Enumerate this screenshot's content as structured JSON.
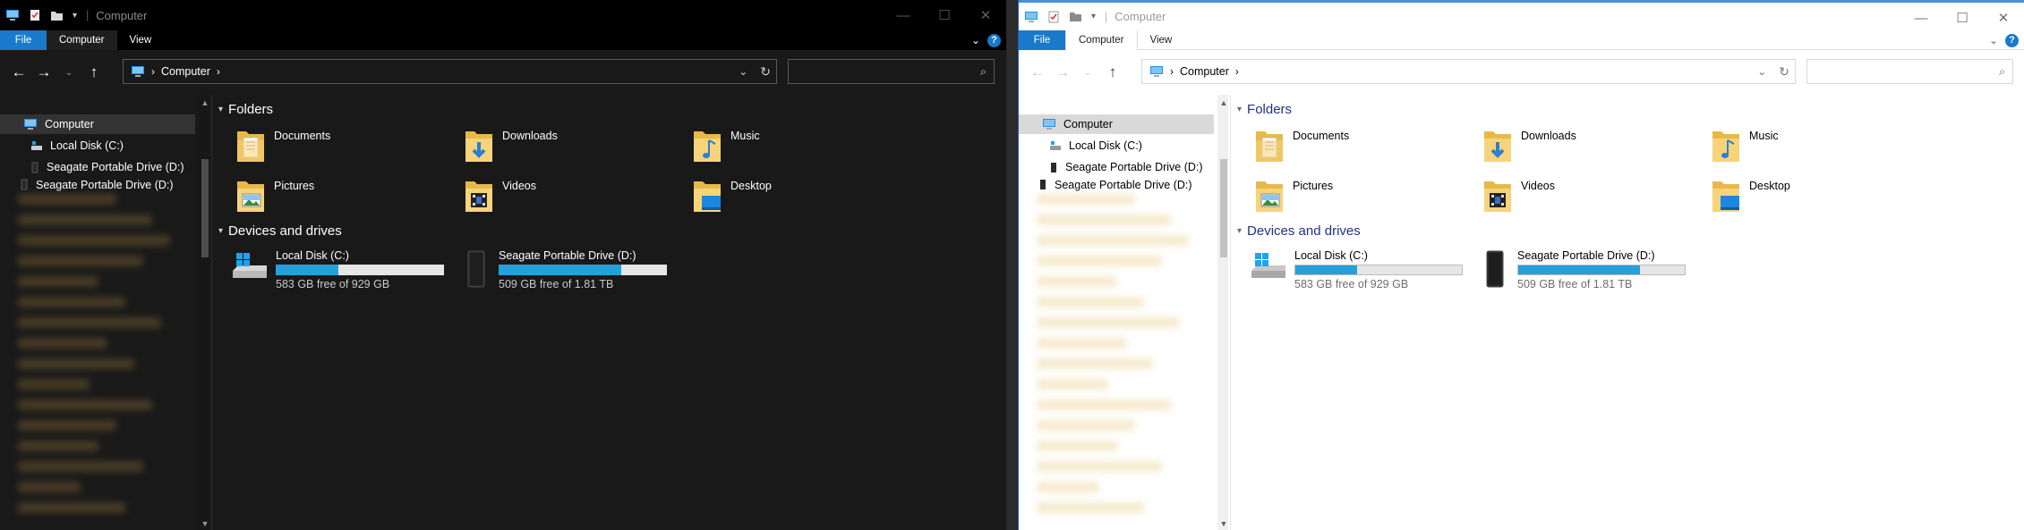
{
  "colors": {
    "accent": "#1979ca",
    "drive_bar_fill": "#26a0da",
    "light_group_header": "#1e3287"
  },
  "windows": [
    {
      "theme": "dark",
      "title": "Computer",
      "ribbon": {
        "file": "File",
        "tabs": [
          "Computer",
          "View"
        ]
      },
      "address": {
        "segments": [
          "Computer"
        ]
      },
      "nav": {
        "computer": "Computer",
        "local_disk": "Local Disk (C:)",
        "seagate": "Seagate Portable Drive (D:)",
        "seagate_dup": "Seagate Portable Drive (D:)"
      },
      "folders_header": "Folders",
      "folders": [
        "Documents",
        "Downloads",
        "Music",
        "Pictures",
        "Videos",
        "Desktop"
      ],
      "devices_header": "Devices and drives",
      "drives": [
        {
          "name": "Local Disk (C:)",
          "free": "583 GB free of 929 GB",
          "used_fraction": 0.37
        },
        {
          "name": "Seagate Portable Drive (D:)",
          "free": "509 GB free of 1.81 TB",
          "used_fraction": 0.73
        }
      ]
    },
    {
      "theme": "light",
      "title": "Computer",
      "ribbon": {
        "file": "File",
        "tabs": [
          "Computer",
          "View"
        ]
      },
      "address": {
        "segments": [
          "Computer"
        ]
      },
      "nav": {
        "computer": "Computer",
        "local_disk": "Local Disk (C:)",
        "seagate": "Seagate Portable Drive (D:)",
        "seagate_dup": "Seagate Portable Drive (D:)"
      },
      "folders_header": "Folders",
      "folders": [
        "Documents",
        "Downloads",
        "Music",
        "Pictures",
        "Videos",
        "Desktop"
      ],
      "devices_header": "Devices and drives",
      "drives": [
        {
          "name": "Local Disk (C:)",
          "free": "583 GB free of 929 GB",
          "used_fraction": 0.37
        },
        {
          "name": "Seagate Portable Drive (D:)",
          "free": "509 GB free of 1.81 TB",
          "used_fraction": 0.73
        }
      ]
    }
  ]
}
